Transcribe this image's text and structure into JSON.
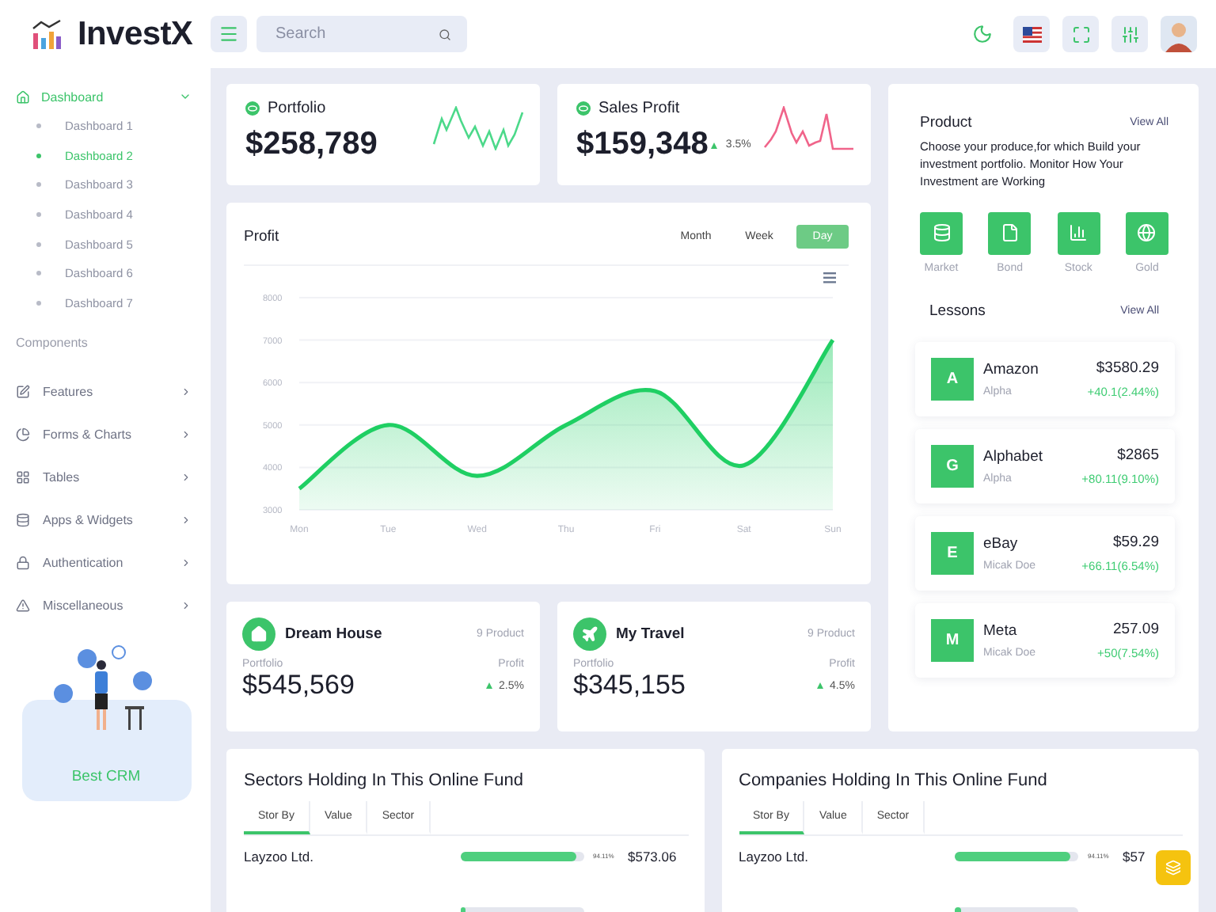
{
  "header": {
    "logo": "InvestX",
    "search": {
      "placeholder": "Search"
    }
  },
  "sidebar": {
    "items": [
      {
        "label": "Dashboard",
        "selected": true,
        "expanded": true,
        "children": [
          {
            "label": "Dashboard 1",
            "selected": false
          },
          {
            "label": "Dashboard 2",
            "selected": true
          },
          {
            "label": "Dashboard 3",
            "selected": false
          },
          {
            "label": "Dashboard 4",
            "selected": false
          },
          {
            "label": "Dashboard 5",
            "selected": false
          },
          {
            "label": "Dashboard 6",
            "selected": false
          },
          {
            "label": "Dashboard 7",
            "selected": false
          }
        ]
      }
    ],
    "section": "Components",
    "menu": [
      {
        "label": "Features",
        "expanded": false
      },
      {
        "label": "Forms & Charts",
        "expanded": false
      },
      {
        "label": "Tables",
        "expanded": false
      },
      {
        "label": "Apps & Widgets",
        "expanded": false
      },
      {
        "label": "Authentication",
        "expanded": false
      },
      {
        "label": "Miscellaneous",
        "expanded": false
      }
    ],
    "promo": "Best CRM"
  },
  "stats": [
    {
      "title": "Portfolio",
      "value": "$258,789",
      "color": "#4cd98a"
    },
    {
      "title": "Sales Profit",
      "value": "$159,348",
      "change": "3.5%",
      "color": "#f0648a"
    }
  ],
  "profit": {
    "tabs": [
      {
        "label": "Month",
        "selected": false
      },
      {
        "label": "Week",
        "selected": false
      },
      {
        "label": "Day",
        "selected": true
      }
    ],
    "chart_data": {
      "type": "area",
      "title": "Profit",
      "grid": true,
      "categories": [
        "Mon",
        "Tue",
        "Wed",
        "Thu",
        "Fri",
        "Sat",
        "Sun"
      ],
      "series": [
        {
          "color": "#1fcf63",
          "values": [
            3500,
            5000,
            3800,
            5000,
            5800,
            4050,
            7000
          ]
        }
      ],
      "ylim": [
        3000,
        8000
      ],
      "yticks": [
        3000,
        4000,
        5000,
        6000,
        7000,
        8000
      ]
    }
  },
  "goals": [
    {
      "title": "Dream House",
      "count": "9 Product",
      "portfolio_label": "Portfolio",
      "value": "$545,569",
      "profit_label": "Profit",
      "change": "2.5%"
    },
    {
      "title": "My Travel",
      "count": "9 Product",
      "portfolio_label": "Portfolio",
      "value": "$345,155",
      "profit_label": "Profit",
      "change": "4.5%"
    }
  ],
  "product": {
    "title": "Product",
    "link": "View All",
    "description": "Choose your produce,for which Build your investment portfolio. Monitor How Your Investment are Working",
    "options": [
      {
        "label": "Market"
      },
      {
        "label": "Bond"
      },
      {
        "label": "Stock"
      },
      {
        "label": "Gold"
      }
    ],
    "lessons_title": "Lessons",
    "lessons_link": "View All",
    "lessons": [
      {
        "initial": "A",
        "name": "Amazon",
        "sub": "Alpha",
        "price": "$3580.29",
        "change": "+40.1(2.44%)"
      },
      {
        "initial": "G",
        "name": "Alphabet",
        "sub": "Alpha",
        "price": "$2865",
        "change": "+80.11(9.10%)"
      },
      {
        "initial": "E",
        "name": "eBay",
        "sub": "Micak Doe",
        "price": "$59.29",
        "change": "+66.11(6.54%)"
      },
      {
        "initial": "M",
        "name": "Meta",
        "sub": "Micak Doe",
        "price": "257.09",
        "change": "+50(7.54%)"
      }
    ]
  },
  "holdings": [
    {
      "title": "Sectors Holding In This Online Fund",
      "tabs": [
        {
          "label": "Stor By",
          "selected": true
        },
        {
          "label": "Value",
          "selected": false
        },
        {
          "label": "Sector",
          "selected": false
        }
      ],
      "rows": [
        {
          "name": "Layzoo Ltd.",
          "level": 0.94,
          "percent": "94.11%",
          "value": "$573.06"
        },
        {
          "level": 0.05
        }
      ]
    },
    {
      "title": "Companies Holding In This Online Fund",
      "tabs": [
        {
          "label": "Stor By",
          "selected": true
        },
        {
          "label": "Value",
          "selected": false
        },
        {
          "label": "Sector",
          "selected": false
        }
      ],
      "rows": [
        {
          "name": "Layzoo Ltd.",
          "level": 0.94,
          "percent": "94.11%",
          "value": "$57"
        },
        {
          "level": 0.05
        }
      ]
    }
  ]
}
